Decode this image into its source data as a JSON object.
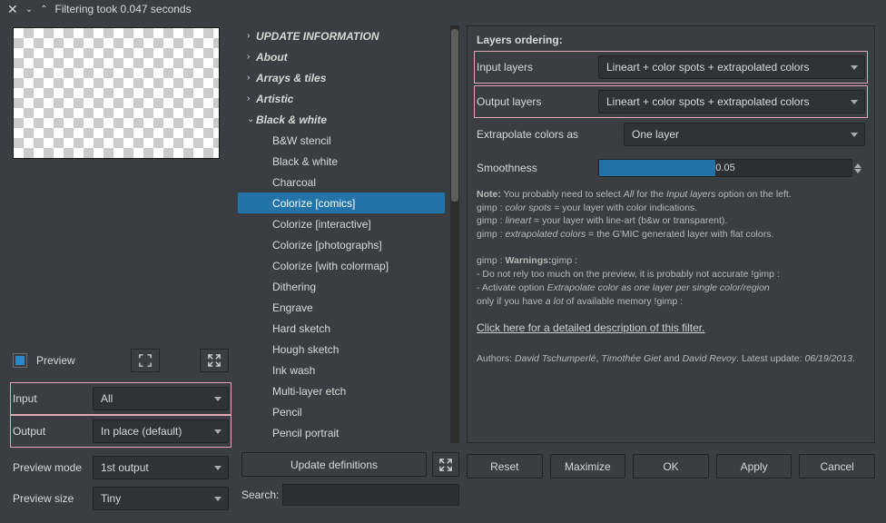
{
  "title": "Filtering took 0.047 seconds",
  "preview_checkbox_label": "Preview",
  "left_controls": {
    "input_label": "Input",
    "input_value": "All",
    "output_label": "Output",
    "output_value": "In place (default)",
    "preview_mode_label": "Preview mode",
    "preview_mode_value": "1st output",
    "preview_size_label": "Preview size",
    "preview_size_value": "Tiny"
  },
  "tree_top": [
    "UPDATE INFORMATION",
    "About",
    "Arrays & tiles",
    "Artistic",
    "Black & white"
  ],
  "tree_sub": [
    "B&W stencil",
    "Black & white",
    "Charcoal",
    "Colorize [comics]",
    "Colorize [interactive]",
    "Colorize [photographs]",
    "Colorize [with colormap]",
    "Dithering",
    "Engrave",
    "Hard sketch",
    "Hough sketch",
    "Ink wash",
    "Multi-layer etch",
    "Pencil",
    "Pencil portrait"
  ],
  "tree_selected": "Colorize [comics]",
  "update_btn": "Update definitions",
  "search_label": "Search:",
  "right": {
    "heading": "Layers ordering:",
    "input_layers_label": "Input layers",
    "input_layers_value": "Lineart + color spots + extrapolated colors",
    "output_layers_label": "Output layers",
    "output_layers_value": "Lineart + color spots + extrapolated colors",
    "extrapolate_label": "Extrapolate colors as",
    "extrapolate_value": "One layer",
    "smoothness_label": "Smoothness",
    "smoothness_value": "0.05",
    "note_html": "<b>Note:</b> You probably need to select <i>All</i> for the <i>Input layers</i> option on the left.<br>gimp : <i>color spots</i> = your layer with color indications.<br>gimp : <i>lineart</i> = your layer with line-art (b&amp;w or transparent).<br>gimp : <i>extrapolated colors</i> = the G'MIC generated layer with flat colors.<br><br>gimp : <b>Warnings:</b>gimp :<br>- Do not rely too much on the preview, it is probably not accurate !gimp :<br>- Activate option <i>Extrapolate color as one layer per single color/region</i><br>only if you have <i>a lot</i> of available memory !gimp :",
    "link_text": "Click here for a detailed description of this filter.",
    "authors_html": "Authors: <i>David Tschumperlé</i>, <i>Timothée Giet</i> and <i>David Revoy</i>. Latest update: <i>06/19/2013</i>."
  },
  "buttons": {
    "reset": "Reset",
    "maximize": "Maximize",
    "ok": "OK",
    "apply": "Apply",
    "cancel": "Cancel"
  }
}
